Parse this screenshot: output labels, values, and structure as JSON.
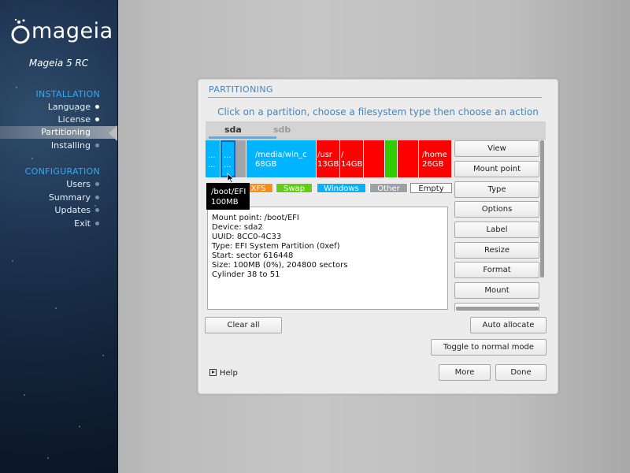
{
  "sidebar": {
    "logo_text": "mageia",
    "version": "Mageia 5 RC",
    "installation_title": "INSTALLATION",
    "installation_items": [
      {
        "label": "Language"
      },
      {
        "label": "License"
      },
      {
        "label": "Partitioning"
      },
      {
        "label": "Installing"
      }
    ],
    "configuration_title": "CONFIGURATION",
    "configuration_items": [
      {
        "label": "Users"
      },
      {
        "label": "Summary"
      },
      {
        "label": "Updates"
      },
      {
        "label": "Exit"
      }
    ]
  },
  "panel": {
    "title": "PARTITIONING",
    "instruction": "Click on a partition, choose a filesystem type then choose an action",
    "disk_tabs": [
      "sda",
      "sdb"
    ],
    "partitions": [
      {
        "line1": "...",
        "line2": "...",
        "color": "#00b4ff"
      },
      {
        "line1": "...",
        "line2": "...",
        "color": "#00b4ff"
      },
      {
        "line1": "",
        "line2": "",
        "color": "#a0a4a8"
      },
      {
        "line1": "/media/win_c",
        "line2": "68GB",
        "color": "#00b4ff"
      },
      {
        "line1": "/usr",
        "line2": "13GB",
        "color": "#ff0000"
      },
      {
        "line1": "/",
        "line2": "14GB",
        "color": "#ff0000"
      },
      {
        "line1": "",
        "line2": "",
        "color": "#ff0000"
      },
      {
        "line1": "",
        "line2": "",
        "color": "#33cc00"
      },
      {
        "line1": "",
        "line2": "",
        "color": "#ff0000"
      },
      {
        "line1": "/home",
        "line2": "26GB",
        "color": "#ff0000"
      }
    ],
    "legend": [
      {
        "label": "XFS",
        "color": "#ff8c1a"
      },
      {
        "label": "Swap",
        "color": "#66cc1a"
      },
      {
        "label": "Windows",
        "color": "#0ab0f5"
      },
      {
        "label": "Other",
        "color": "#9aa0a6"
      },
      {
        "label": "Empty",
        "color": "#ffffff"
      }
    ],
    "tooltip": {
      "line1": "/boot/EFI",
      "line2": "100MB"
    },
    "info_lines": [
      "Mount point: /boot/EFI",
      "Device: sda2",
      "UUID: 8CC0-4C33",
      "Type: EFI System Partition (0xef)",
      "Start: sector 616448",
      "Size: 100MB (0%), 204800 sectors",
      "Cylinder 38 to 51"
    ],
    "actions": [
      "View",
      "Mount point",
      "Type",
      "Options",
      "Label",
      "Resize",
      "Format",
      "Mount"
    ],
    "clear_all": "Clear all",
    "auto_allocate": "Auto allocate",
    "toggle_mode": "Toggle to normal mode",
    "help": "Help",
    "more": "More",
    "done": "Done"
  }
}
